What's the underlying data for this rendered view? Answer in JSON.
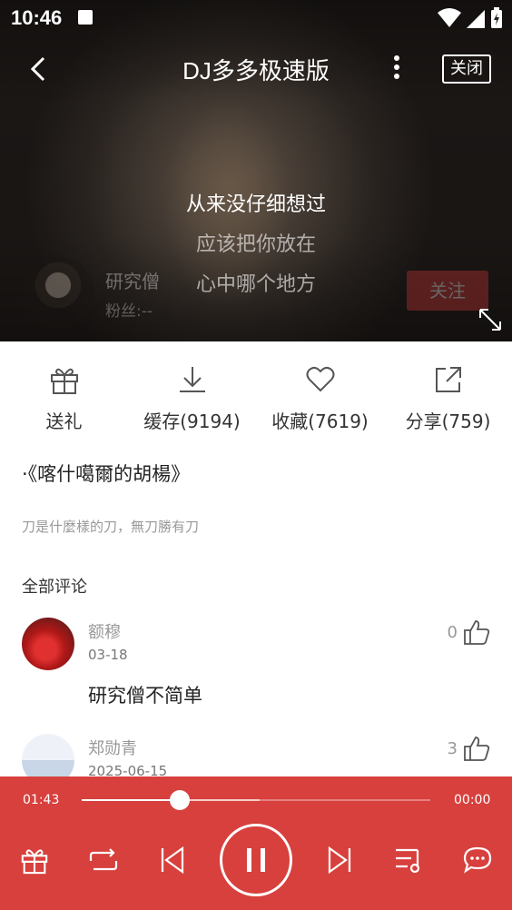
{
  "status": {
    "time": "10:46"
  },
  "header": {
    "title": "DJ多多极速版",
    "close_label": "关闭"
  },
  "singer": {
    "name": "研究僧",
    "fans": "粉丝:--",
    "follow_label": "关注"
  },
  "lyrics": {
    "current": "从来没仔细想过",
    "next": [
      "应该把你放在",
      "心中哪个地方"
    ]
  },
  "actions": [
    {
      "label": "送礼",
      "icon": "gift-icon"
    },
    {
      "label": "缓存(9194)",
      "icon": "download-icon"
    },
    {
      "label": "收藏(7619)",
      "icon": "heart-icon"
    },
    {
      "label": "分享(759)",
      "icon": "share-icon"
    }
  ],
  "song": {
    "title": "·《喀什噶爾的胡楊》",
    "description": "刀是什麼樣的刀，無刀勝有刀"
  },
  "comments_header": "全部评论",
  "comments": [
    {
      "name": "额穆",
      "date": "03-18",
      "text": "研究僧不简单",
      "likes": "0"
    },
    {
      "name": "郑勋青",
      "date": "2025-06-15",
      "text": "",
      "likes": "3"
    }
  ],
  "player": {
    "elapsed": "01:43",
    "total": "00:00",
    "progress": 0.28,
    "buffered": 0.51,
    "controls": [
      "gift-icon",
      "repeat-icon",
      "previous-icon",
      "pause-icon",
      "next-icon",
      "playlist-icon",
      "comment-icon"
    ]
  },
  "colors": {
    "accent": "#d7403d"
  }
}
